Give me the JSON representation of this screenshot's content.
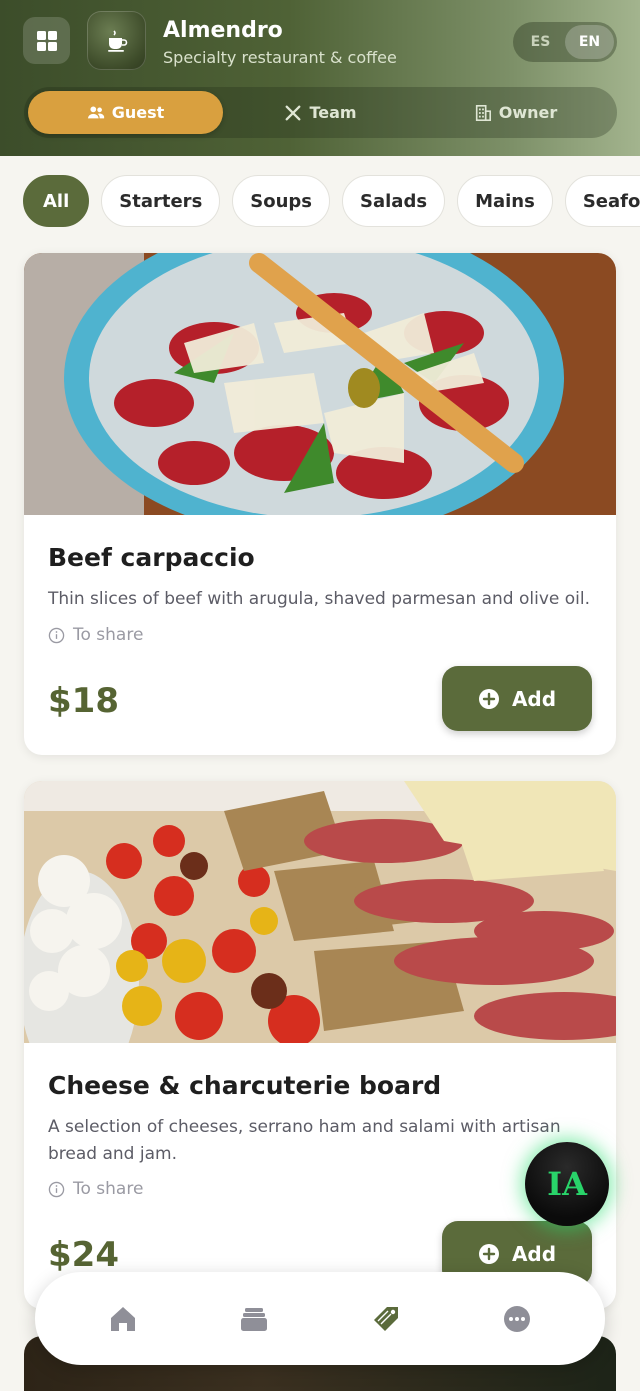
{
  "header": {
    "title": "Almendro",
    "subtitle": "Specialty restaurant & coffee",
    "languages": [
      "ES",
      "EN"
    ],
    "active_language": "EN",
    "roles": [
      {
        "label": "Guest",
        "icon": "users-icon",
        "active": true
      },
      {
        "label": "Team",
        "icon": "utensils-icon",
        "active": false
      },
      {
        "label": "Owner",
        "icon": "building-icon",
        "active": false
      }
    ]
  },
  "categories": [
    "All",
    "Starters",
    "Soups",
    "Salads",
    "Mains",
    "Seafood"
  ],
  "active_category": "All",
  "items": [
    {
      "name": "Beef carpaccio",
      "description": "Thin slices of beef with arugula, shaved parmesan and olive oil.",
      "tag": "To share",
      "price": "$18",
      "add_label": "Add"
    },
    {
      "name": "Cheese & charcuterie board",
      "description": "A selection of cheeses, serrano ham and salami with artisan bread and jam.",
      "tag": "To share",
      "price": "$24",
      "add_label": "Add"
    }
  ],
  "ai_button": {
    "label": "IA"
  },
  "bottom_nav": [
    {
      "icon": "home-icon"
    },
    {
      "icon": "layers-icon"
    },
    {
      "icon": "tag-icon",
      "active": true
    },
    {
      "icon": "more-icon"
    }
  ],
  "colors": {
    "accent_green": "#5b6b3b",
    "guest_gold": "#d9a03f",
    "price_green": "#566433",
    "ai_glow": "#29d46a"
  }
}
